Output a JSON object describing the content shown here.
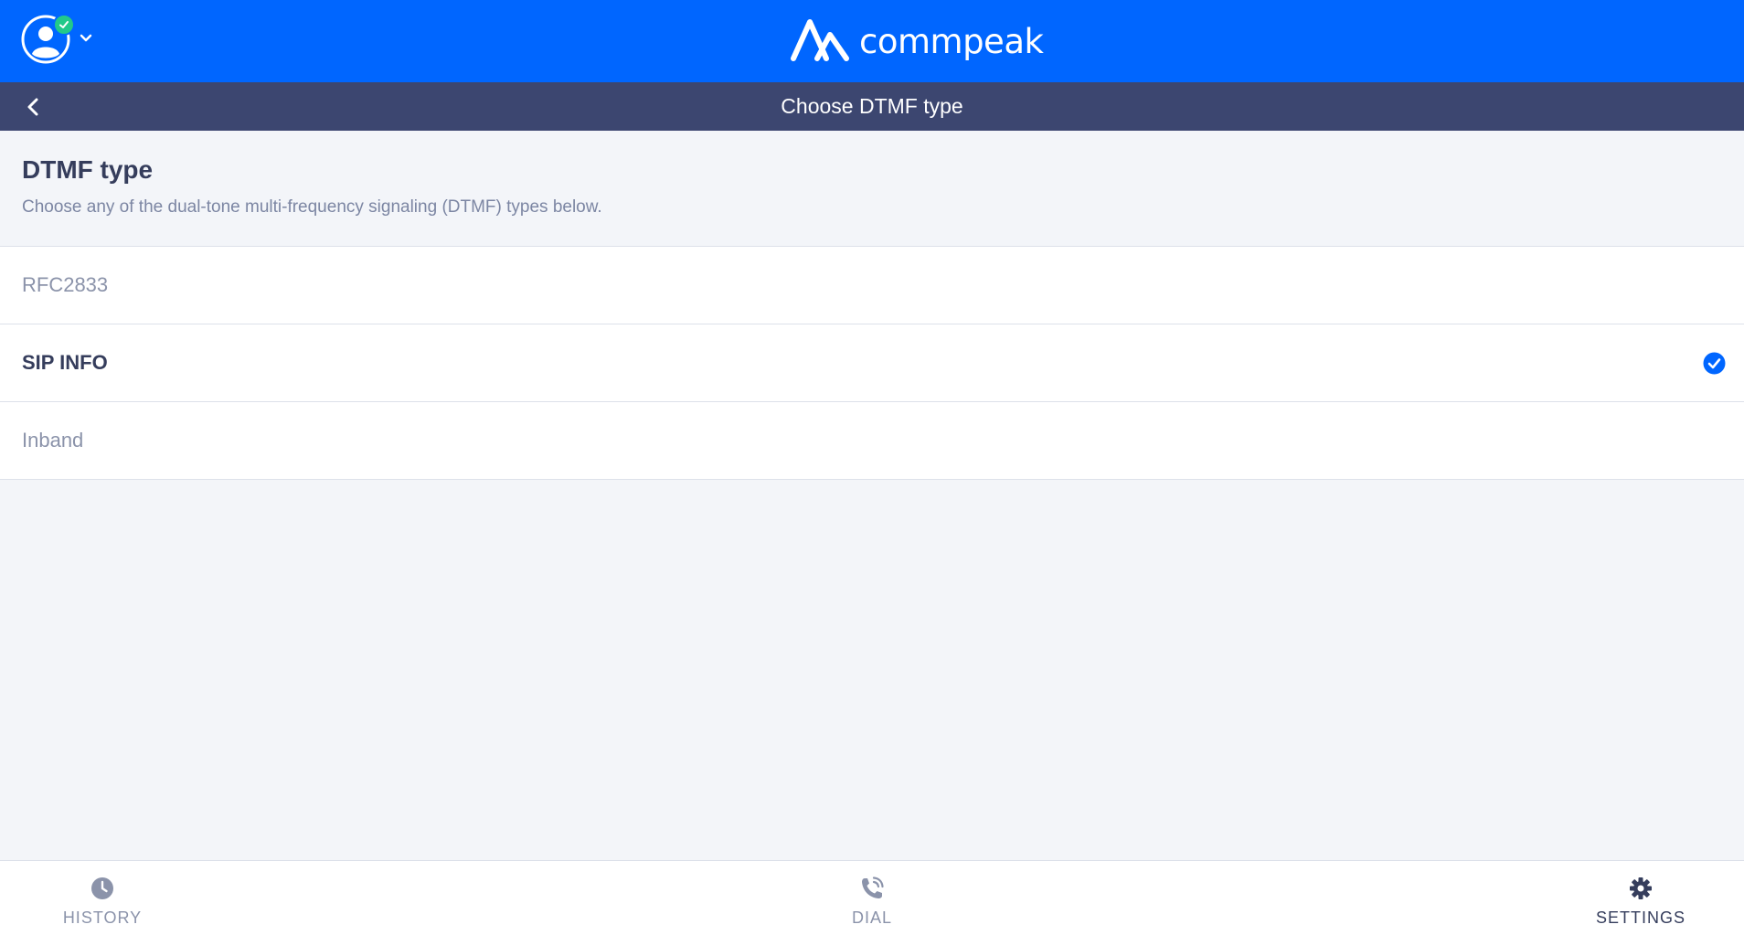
{
  "header": {
    "brand_name": "commpeak",
    "colors": {
      "primary": "#0066ff",
      "subheader": "#3c4670",
      "online": "#22c98a"
    }
  },
  "subheader": {
    "title": "Choose DTMF type"
  },
  "section": {
    "title": "DTMF type",
    "description": "Choose any of the dual-tone multi-frequency signaling (DTMF) types below."
  },
  "options": [
    {
      "label": "RFC2833",
      "selected": false
    },
    {
      "label": "SIP INFO",
      "selected": true
    },
    {
      "label": "Inband",
      "selected": false
    }
  ],
  "nav": [
    {
      "label": "HISTORY",
      "icon": "clock-icon",
      "active": false
    },
    {
      "label": "DIAL",
      "icon": "phone-icon",
      "active": false
    },
    {
      "label": "SETTINGS",
      "icon": "gear-icon",
      "active": true
    }
  ]
}
